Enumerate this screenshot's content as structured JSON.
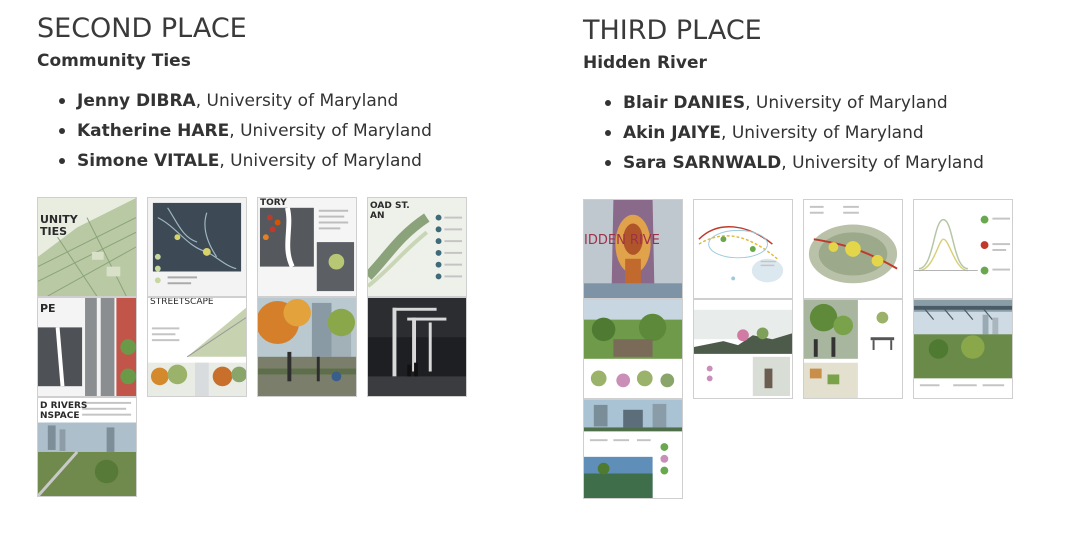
{
  "second": {
    "title": "SECOND PLACE",
    "project": "Community Ties",
    "members": [
      {
        "name": "Jenny DIBRA",
        "affiliation": ", University of Maryland"
      },
      {
        "name": "Katherine HARE",
        "affiliation": ", University of Maryland"
      },
      {
        "name": "Simone VITALE",
        "affiliation": ", University of Maryland"
      }
    ],
    "thumb_text": {
      "t1a": "UNITY",
      "t1b": "TIES",
      "t3": "TORY",
      "t4a": "OAD ST.",
      "t4b": "AN",
      "t5": "PE",
      "t6": "STREETSCAPE",
      "t9a": "D RIVERS",
      "t9b": "NSPACE"
    }
  },
  "third": {
    "title": "THIRD PLACE",
    "project": "Hidden River",
    "members": [
      {
        "name": "Blair DANIES",
        "affiliation": ", University of Maryland"
      },
      {
        "name": "Akin JAIYE",
        "affiliation": ", University of Maryland"
      },
      {
        "name": "Sara SARNWALD",
        "affiliation": ", University of Maryland"
      }
    ],
    "thumb_text": {
      "t1": "IDDEN RIVE"
    }
  },
  "colors": {
    "text": "#333333",
    "thumb_border": "#cfcfcf"
  }
}
